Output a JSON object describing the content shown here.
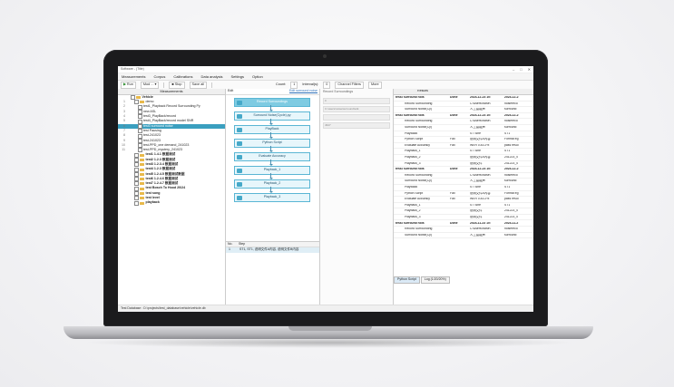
{
  "window": {
    "title": "Software - (Title)"
  },
  "menu": [
    "Measurements",
    "Corpus",
    "Calibrations",
    "Data analysis",
    "Settings",
    "Option"
  ],
  "toolbar": {
    "run_label": "Run",
    "device_value": "Mod ...",
    "stop_label": "Stop",
    "save_label": "Save all",
    "count_label": "Count:",
    "count_value": "1",
    "interval_label": "Interval(s):",
    "interval_value": "0",
    "channel_filter": "Channel Filters",
    "more": "More"
  },
  "left_panel": {
    "header": "Measurements",
    "rows": [
      {
        "num": "",
        "label": "Vehicle",
        "bold": true,
        "indent": 1,
        "folder": true
      },
      {
        "num": "1",
        "label": "demo",
        "bold": false,
        "indent": 2,
        "folder": true
      },
      {
        "num": "2",
        "label": "test1_Playback Record Surrounding Py",
        "bold": false,
        "indent": 3,
        "folder": false
      },
      {
        "num": "3",
        "label": "new ASL",
        "bold": false,
        "indent": 3,
        "folder": false
      },
      {
        "num": "4",
        "label": "test3_PlayBack/record",
        "bold": false,
        "indent": 3,
        "folder": false
      },
      {
        "num": "5",
        "label": "test4_PlayBack/record model SNR",
        "bold": false,
        "indent": 3,
        "folder": false
      },
      {
        "num": "6",
        "label": "test3 surround noise",
        "bold": false,
        "indent": 3,
        "folder": false,
        "selected": true
      },
      {
        "num": "7",
        "label": "test Pausing",
        "bold": false,
        "indent": 3,
        "folder": false
      },
      {
        "num": "8",
        "label": "test-241023",
        "bold": false,
        "indent": 3,
        "folder": false
      },
      {
        "num": "9",
        "label": "test-241023",
        "bold": false,
        "indent": 3,
        "folder": false
      },
      {
        "num": "10",
        "label": "test-PPD_one demand_241023",
        "bold": false,
        "indent": 3,
        "folder": false
      },
      {
        "num": "11",
        "label": "test-PPD_mystery_241023",
        "bold": false,
        "indent": 3,
        "folder": false
      },
      {
        "num": "",
        "label": "test1  1.4.1 数据测试",
        "bold": true,
        "indent": 2,
        "folder": true
      },
      {
        "num": "",
        "label": "test2  1.2.3 数据测试",
        "bold": true,
        "indent": 2,
        "folder": true
      },
      {
        "num": "",
        "label": "test3  1.2.3.4 数据测试",
        "bold": true,
        "indent": 2,
        "folder": true
      },
      {
        "num": "",
        "label": "test4  1.2.3 数据测试",
        "bold": true,
        "indent": 2,
        "folder": true
      },
      {
        "num": "",
        "label": "test5  1.2.4.5 数据测试数据",
        "bold": true,
        "indent": 2,
        "folder": true
      },
      {
        "num": "",
        "label": "test6  1.2.4.6 数据测试",
        "bold": true,
        "indent": 2,
        "folder": true
      },
      {
        "num": "",
        "label": "test7  1.2.4.7 数据测试",
        "bold": true,
        "indent": 2,
        "folder": true
      },
      {
        "num": "",
        "label": "test Bosch To Hood 20/24",
        "bold": true,
        "indent": 2,
        "folder": true
      },
      {
        "num": "",
        "label": "test song",
        "bold": true,
        "indent": 2,
        "folder": true
      },
      {
        "num": "",
        "label": "test level",
        "bold": true,
        "indent": 2,
        "folder": true
      },
      {
        "num": "",
        "label": "playback",
        "bold": true,
        "indent": 2,
        "folder": true
      }
    ]
  },
  "flow_panel": {
    "tool_label": "Edit",
    "link_label": "Edit surround noise",
    "nodes": [
      "Record Surroundings",
      "Surround Noise(Cycle).py",
      "PlayBack",
      "Python Script",
      "Evaluate Accuracy",
      "Playback_1",
      "Playback_2",
      "Playback_3"
    ],
    "steps_header": [
      "No.",
      "Step"
    ],
    "steps_row": [
      "1",
      "ST1, ST1, 说明文件A内容, 说明文件B内容"
    ]
  },
  "prop_panel": {
    "label": "Record Surroundings",
    "fields": [
      "0",
      "C:\\users\\noise\\surround\\sdk",
      "",
      "4627"
    ]
  },
  "right_panel": {
    "header": [
      "Results",
      "",
      "",
      ""
    ],
    "rows": [
      {
        "grp": true,
        "c1": "test3 surround nois",
        "c2": "Done",
        "c3": "2024-12-23 10:",
        "c4": "2024-12-2"
      },
      {
        "grp": false,
        "c1": "Record Surrounding",
        "c2": "",
        "c3": "C:\\users\\noise\\",
        "c4": "noisereco"
      },
      {
        "grp": false,
        "c1": "Surround Noise(Cy)",
        "c2": "",
        "c3": "人工智能声",
        "c4": "surround"
      },
      {
        "grp": true,
        "c1": "test3 surround nois",
        "c2": "Done",
        "c3": "2024-12-23 10:",
        "c4": "2024-12-2"
      },
      {
        "grp": false,
        "c1": "Record Surrounding",
        "c2": "",
        "c3": "C:\\users\\noise\\",
        "c4": "noisereco"
      },
      {
        "grp": false,
        "c1": "Surround Noise(Cy)",
        "c2": "",
        "c3": "人工智能声",
        "c4": "surround"
      },
      {
        "grp": false,
        "c1": "PlayBack",
        "c2": "",
        "c3": "ST Sine",
        "c4": "ST1"
      },
      {
        "grp": false,
        "c1": "Python Script",
        "c2": "Fail",
        "c3": "说明文件A内容",
        "c4": "Format eg"
      },
      {
        "grp": false,
        "c1": "Evaluate Accuracy",
        "c2": "Fail",
        "c3": "WER 0.83 2%",
        "c4": "pass resul"
      },
      {
        "grp": false,
        "c1": "Playback_1",
        "c2": "",
        "c3": "ST Sine",
        "c4": "ST1"
      },
      {
        "grp": false,
        "c1": "Playback_2",
        "c2": "",
        "c3": "说明文件A内容",
        "c4": "241223_0"
      },
      {
        "grp": false,
        "c1": "Playback_3",
        "c2": "",
        "c3": "说明文件",
        "c4": "241223_0"
      },
      {
        "grp": true,
        "c1": "test3 surround nois",
        "c2": "Done",
        "c3": "2024-12-23 10:",
        "c4": "2024-12-2"
      },
      {
        "grp": false,
        "c1": "Record Surrounding",
        "c2": "",
        "c3": "C:\\users\\noise\\",
        "c4": "noisereco"
      },
      {
        "grp": false,
        "c1": "Surround Noise(Cy)",
        "c2": "",
        "c3": "人工智能声",
        "c4": "surround"
      },
      {
        "grp": false,
        "c1": "PlayBack",
        "c2": "",
        "c3": "ST Sine",
        "c4": "ST1"
      },
      {
        "grp": false,
        "c1": "Python Script",
        "c2": "Fail",
        "c3": "说明文件A内容",
        "c4": "Format eg"
      },
      {
        "grp": false,
        "c1": "Evaluate Accuracy",
        "c2": "Fail",
        "c3": "WER 0.83 2%",
        "c4": "pass resul"
      },
      {
        "grp": false,
        "c1": "Playback_1",
        "c2": "",
        "c3": "ST Sine",
        "c4": "ST1"
      },
      {
        "grp": false,
        "c1": "Playback_2",
        "c2": "",
        "c3": "说明文件",
        "c4": "241223_0"
      },
      {
        "grp": false,
        "c1": "Playback_3",
        "c2": "",
        "c3": "说明文件",
        "c4": "241223_0"
      },
      {
        "grp": true,
        "c1": "test3 surround nois",
        "c2": "Done",
        "c3": "2024-11-23 10:",
        "c4": "2024-11-2"
      },
      {
        "grp": false,
        "c1": "Record Surrounding",
        "c2": "",
        "c3": "C:\\users\\noise\\",
        "c4": "noisereco"
      },
      {
        "grp": false,
        "c1": "Surround Noise(Cy)",
        "c2": "",
        "c3": "人工智能声",
        "c4": "surround"
      }
    ],
    "tabs": [
      "Python Script",
      "Log (1/20/20%)"
    ]
  },
  "status": {
    "text": "Test Database : D:\\projects\\test_database\\vehicle\\vehicle.db"
  }
}
